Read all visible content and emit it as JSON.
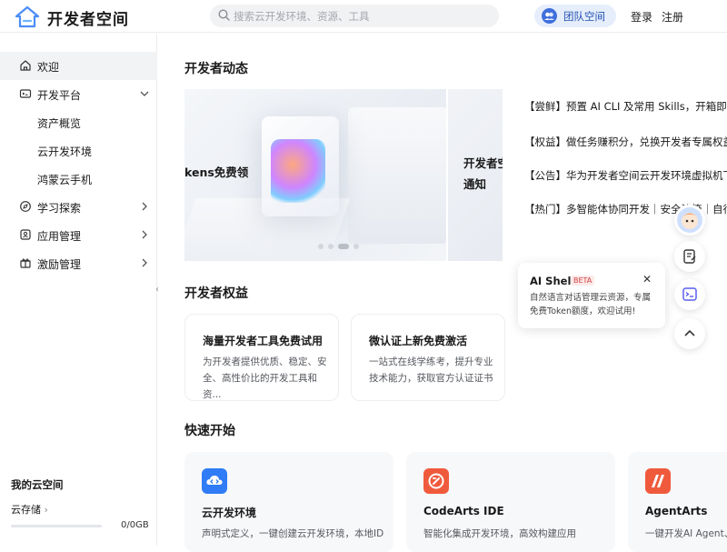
{
  "header": {
    "brand": "开发者空间",
    "search_placeholder": "搜索云开发环境、资源、工具",
    "team_space": "团队空间",
    "login": "登录",
    "register": "注册"
  },
  "sidebar": {
    "items": [
      {
        "label": "欢迎",
        "icon": "home-icon"
      },
      {
        "label": "开发平台",
        "icon": "terminal-icon"
      },
      {
        "label": "资产概览"
      },
      {
        "label": "云开发环境"
      },
      {
        "label": "鸿蒙云手机"
      },
      {
        "label": "学习探索",
        "icon": "compass-icon"
      },
      {
        "label": "应用管理",
        "icon": "app-icon"
      },
      {
        "label": "激励管理",
        "icon": "gift-icon"
      }
    ],
    "my_cloud": "我的云空间",
    "storage_label": "云存储",
    "storage_value": "0/0GB",
    "storage_fraction": 0
  },
  "dynamics": {
    "title": "开发者动态",
    "banner_text": "kens免费领",
    "banner2_text": "开发者空\n通知",
    "news": [
      "【尝鲜】预置 AI CLI 及常用 Skills，开箱即用作",
      "【权益】做任务赚积分，兑换开发者专属权益",
      "【公告】华为开发者空间云开发环境虚拟机下线",
      "【热门】多智能体协同开发｜安全沙箱｜自行｜鸿"
    ]
  },
  "benefits": {
    "title": "开发者权益",
    "cards": [
      {
        "title": "海量开发者工具免费试用",
        "desc": "为开发者提供优质、稳定、安全、高性价比的开发工具和资..."
      },
      {
        "title": "微认证上新免费激活",
        "desc": "一站式在线学练考，提升专业技术能力，获取官方认证证书"
      }
    ]
  },
  "quickstart": {
    "title": "快速开始",
    "cards": [
      {
        "title": "云开发环境",
        "desc": "声明式定义，一键创建云开发环境，本地IDE/C",
        "color": "#2f7cf6"
      },
      {
        "title": "CodeArts IDE",
        "desc": "智能化集成开发环境，高效构建应用",
        "color": "#f05a3c"
      },
      {
        "title": "AgentArts",
        "desc": "一键开发AI Agent、部",
        "color": "#f05a3c"
      }
    ]
  },
  "ai_tip": {
    "title": "AI Shell",
    "badge": "BETA",
    "text": "自然语言对话管理云资源，专属免费Token额度，欢迎试用!"
  }
}
